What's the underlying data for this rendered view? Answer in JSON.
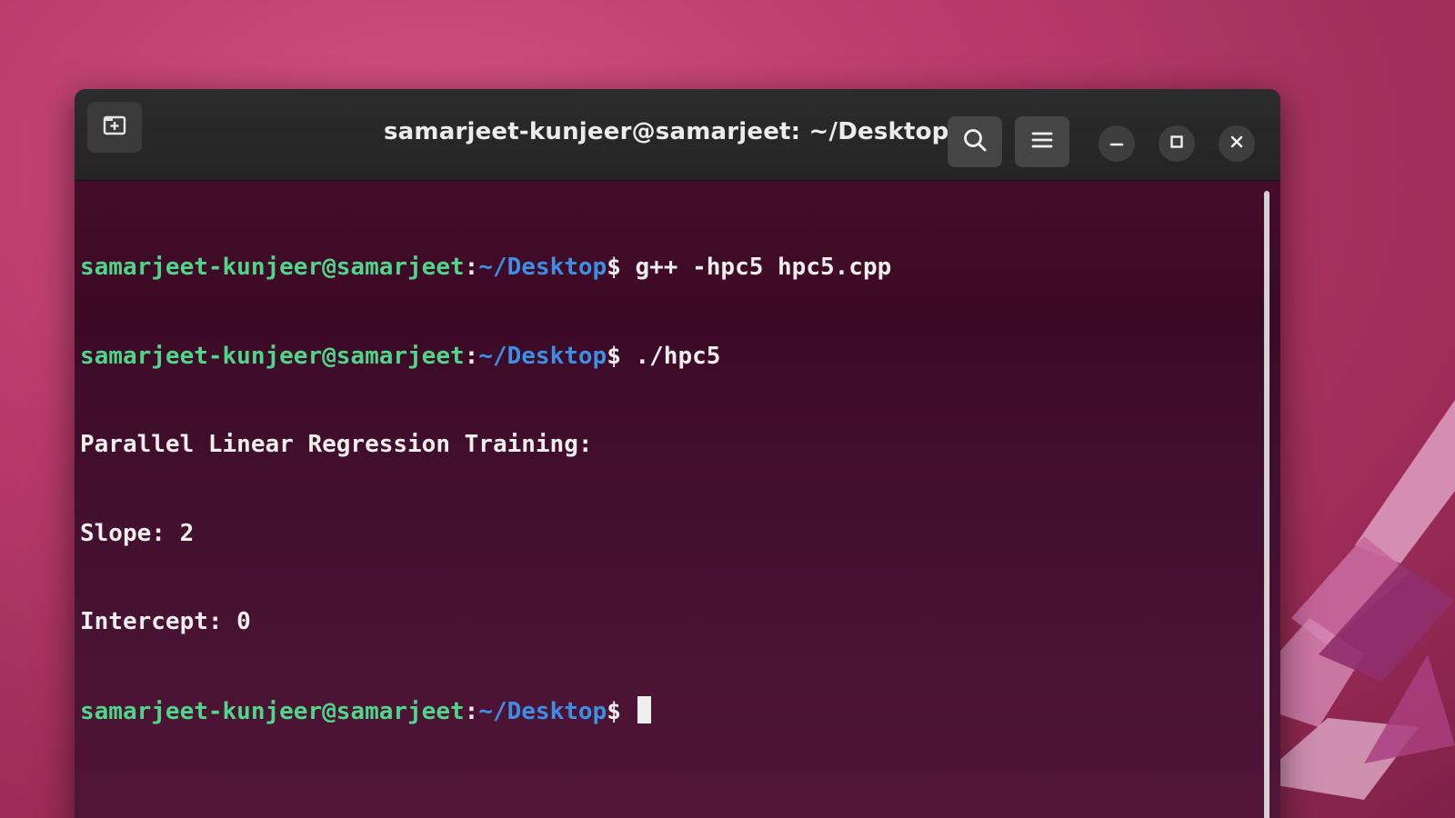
{
  "window": {
    "title": "samarjeet-kunjeer@samarjeet: ~/Desktop"
  },
  "icons": {
    "new_tab": "new-tab-icon",
    "search": "search-icon",
    "menu": "hamburger-menu-icon",
    "minimize": "minimize-icon",
    "maximize": "maximize-icon",
    "close": "close-icon"
  },
  "terminal": {
    "lines": [
      {
        "user_host": "samarjeet-kunjeer@samarjeet",
        "sep": ":",
        "path": "~/Desktop",
        "dollar": "$",
        "command": " g++ -hpc5 hpc5.cpp"
      },
      {
        "user_host": "samarjeet-kunjeer@samarjeet",
        "sep": ":",
        "path": "~/Desktop",
        "dollar": "$",
        "command": " ./hpc5"
      },
      {
        "output": "Parallel Linear Regression Training:"
      },
      {
        "output": "Slope: 2"
      },
      {
        "output": "Intercept: 0"
      },
      {
        "user_host": "samarjeet-kunjeer@samarjeet",
        "sep": ":",
        "path": "~/Desktop",
        "dollar": "$",
        "command": " "
      }
    ]
  },
  "colors": {
    "prompt_user": "#4fd68a",
    "prompt_path": "#3d8fe6",
    "text": "#eeeeec",
    "terminal_bg": "#3c0a25",
    "headerbar_bg": "#2c2c2c",
    "wallpaper": "#b83a6a"
  }
}
